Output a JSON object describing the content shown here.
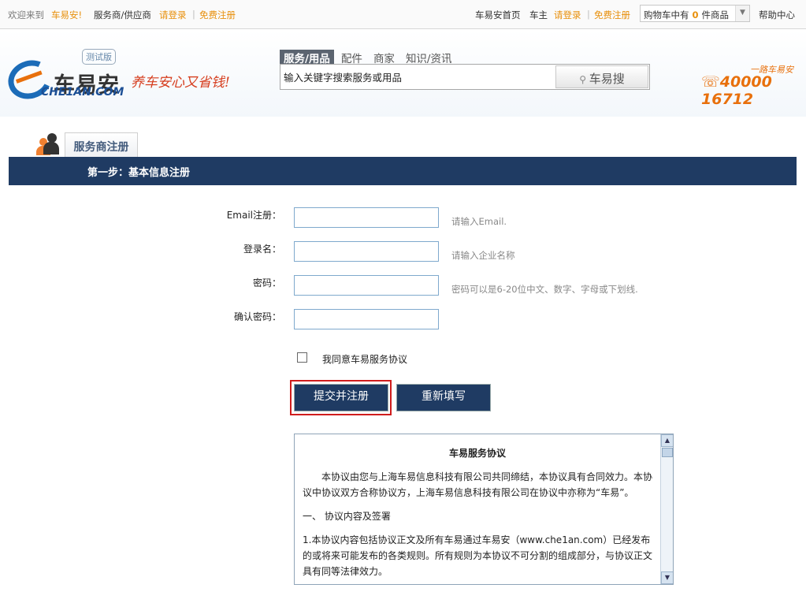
{
  "topbar": {
    "welcome": "欢迎来到",
    "brand": "车易安!",
    "provider": "服务商/供应商",
    "login": "请登录",
    "sep": "|",
    "register": "免费注册",
    "home": "车易安首页",
    "owner": "车主",
    "login2": "请登录",
    "register2": "免费注册",
    "cart_prefix": "购物车中有",
    "cart_count": "0",
    "cart_suffix": "件商品",
    "help": "帮助中心"
  },
  "header": {
    "logo_cn": "车易安",
    "logo_en": "CHE1AN.COM",
    "beta": "测试版",
    "slogan": "养车安心又省钱!",
    "tabs": [
      "服务/用品",
      "配件",
      "商家",
      "知识/资讯"
    ],
    "search_placeholder": "输入关键字搜索服务或用品",
    "search_button": "车易搜",
    "hotline_label": "一路车易安",
    "hotline": "40000 16712"
  },
  "page": {
    "tab_title": "服务商注册",
    "step": "第一步：基本信息注册"
  },
  "form": {
    "email_label": "Email注册：",
    "email_hint": "请输入Email.",
    "login_label": "登录名：",
    "login_hint": "请输入企业名称",
    "pwd_label": "密码：",
    "pwd_hint": "密码可以是6-20位中文、数字、字母或下划线.",
    "confirm_label": "确认密码：",
    "agree": "我同意车易服务协议",
    "submit": "提交并注册",
    "reset": "重新填写"
  },
  "agreement": {
    "title": "车易服务协议",
    "p1": "本协议由您与上海车易信息科技有限公司共同缔结，本协议具有合同效力。本协议中协议双方合称协议方，上海车易信息科技有限公司在协议中亦称为“车易”。",
    "p2": "一、 协议内容及签署",
    "p3": "1.本协议内容包括协议正文及所有车易通过车易安（www.che1an.com）已经发布的或将来可能发布的各类规则。所有规则为本协议不可分割的组成部分，与协议正文具有同等法律效力。"
  }
}
